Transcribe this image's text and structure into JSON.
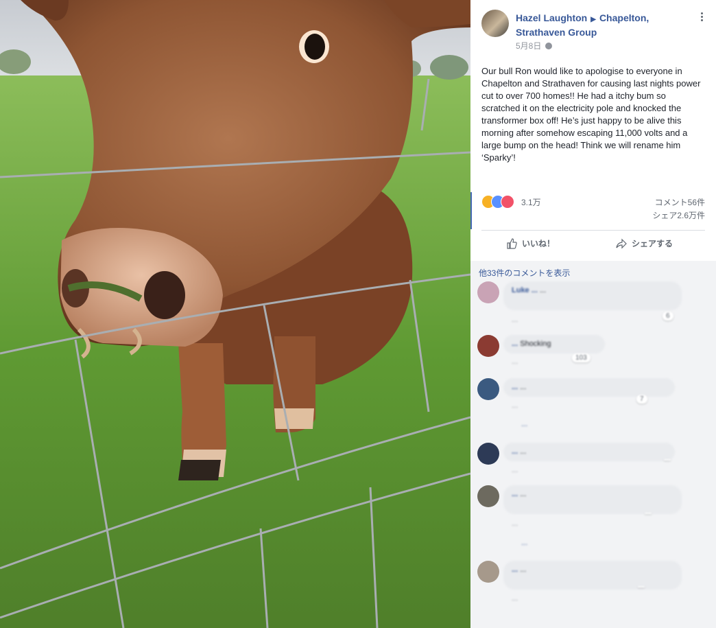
{
  "post": {
    "author": "Hazel Laughton",
    "group": "Chapelton, Strathaven Group",
    "date": "5月8日",
    "body": "Our bull Ron would like to apologise to everyone in Chapelton and Strathaven for causing last nights power cut to over 700 homes!! He had a itchy bum so scratched it on the electricity pole and knocked the transformer box off! He’s just happy to be alive this morning after somehow escaping 11,000 volts and a large bump on the head! Think we will rename him ‘Sparky’!",
    "reaction_count": "3.1万",
    "comment_count": "コメント56件",
    "share_count": "シェア2.6万件",
    "like_label": "いいね！",
    "share_label": "シェアする",
    "view_more": "他33件のコメントを表示"
  },
  "comments": [
    {
      "author": "Luke ...",
      "text": "...",
      "meta": "...",
      "reactions": "6"
    },
    {
      "author": "...",
      "text": "Shocking",
      "meta": "...",
      "reactions": "103"
    },
    {
      "author": "...",
      "text": "...",
      "meta": "...",
      "reactions": "7"
    },
    {
      "author": "...",
      "text": "...",
      "meta": "...",
      "reactions": ""
    },
    {
      "author": "...",
      "text": "...",
      "meta": "...",
      "reactions": ""
    },
    {
      "author": "...",
      "text": "...",
      "meta": "...",
      "reactions": ""
    }
  ],
  "replies": [
    "...",
    "..."
  ],
  "colors": {
    "link": "#385898",
    "brand": "#4267b2",
    "bubble": "#e9ebee"
  },
  "icons": [
    "globe-icon",
    "more-icon",
    "like-icon",
    "share-icon",
    "haha-icon",
    "love-icon"
  ]
}
